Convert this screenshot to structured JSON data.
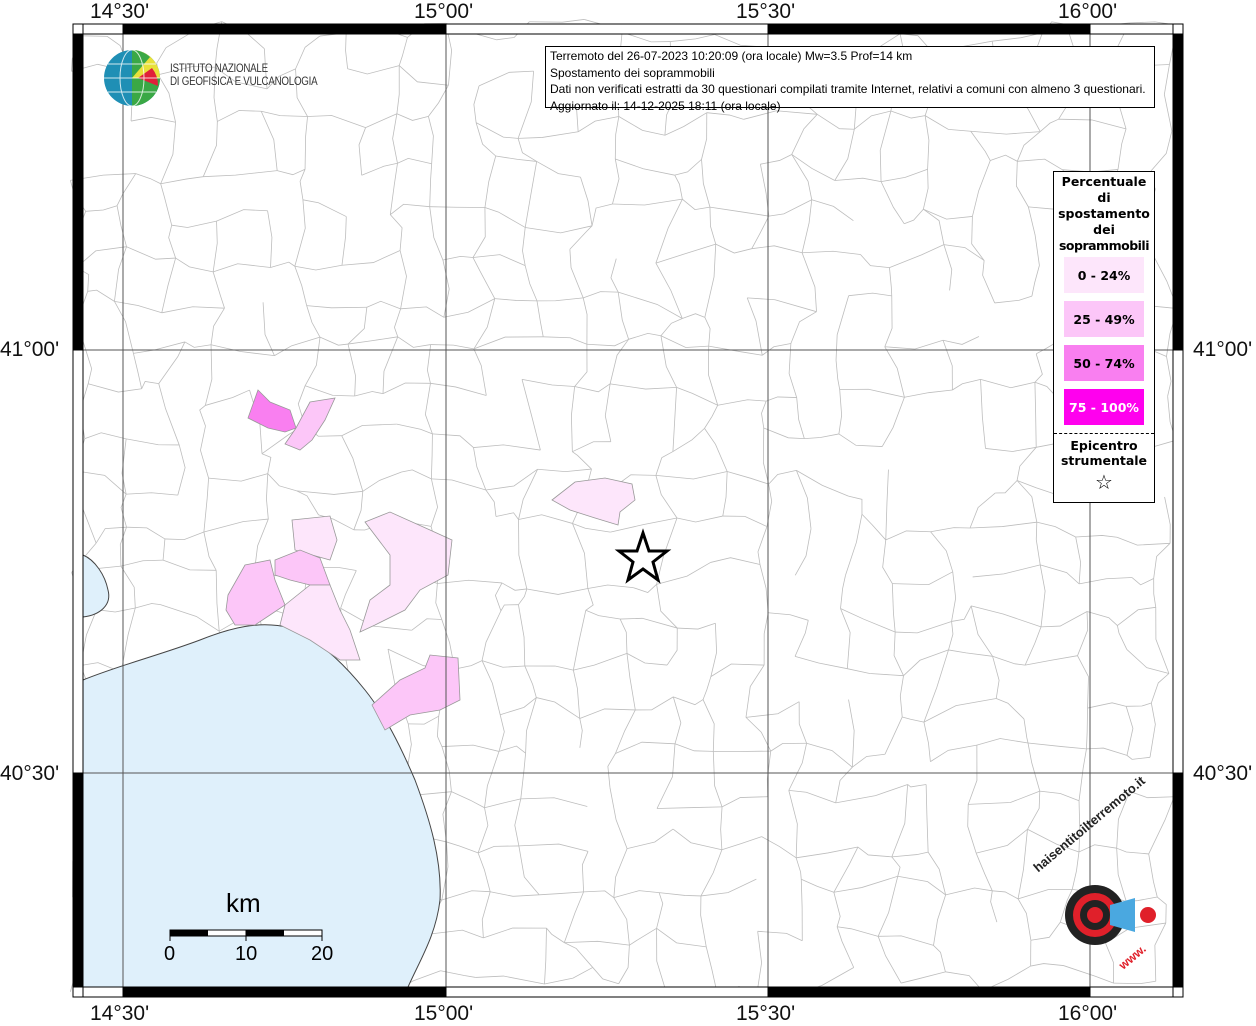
{
  "axes": {
    "lon_labels": [
      "14°30'",
      "15°00'",
      "15°30'",
      "16°00'"
    ],
    "lat_labels": [
      "41°00'",
      "40°30'"
    ]
  },
  "info": {
    "line1": "Terremoto del 26-07-2023 10:20:09 (ora locale) Mw=3.5 Prof=14 km",
    "line2": "Spostamento dei soprammobili",
    "line3": "Dati non verificati estratti da 30 questionari compilati tramite Internet, relativi a comuni con almeno 3 questionari.",
    "line4": "Aggiornato il: 14-12-2025 18:11 (ora locale)"
  },
  "logo": {
    "line1": "ISTITUTO NAZIONALE",
    "line2": "DI GEOFISICA E VULCANOLOGIA"
  },
  "legend": {
    "title": [
      "Percentuale",
      "di",
      "spostamento",
      "dei",
      "soprammobili"
    ],
    "classes": [
      {
        "label": "0 - 24%",
        "color": "#fde6fb"
      },
      {
        "label": "25 - 49%",
        "color": "#fcc6f8"
      },
      {
        "label": "50 - 74%",
        "color": "#f97ff0"
      },
      {
        "label": "75 - 100%",
        "color": "#ff00ee"
      }
    ],
    "epicenter_label": [
      "Epicentro",
      "strumentale"
    ]
  },
  "scale": {
    "unit": "km",
    "ticks": [
      "0",
      "10",
      "20"
    ]
  },
  "sentito_logo": {
    "text": "haisentitoilterremoto.it",
    "url": "www."
  },
  "colors": {
    "sea": "#dff0fb",
    "grid": "#555555",
    "boundary": "#b8b8b8"
  }
}
